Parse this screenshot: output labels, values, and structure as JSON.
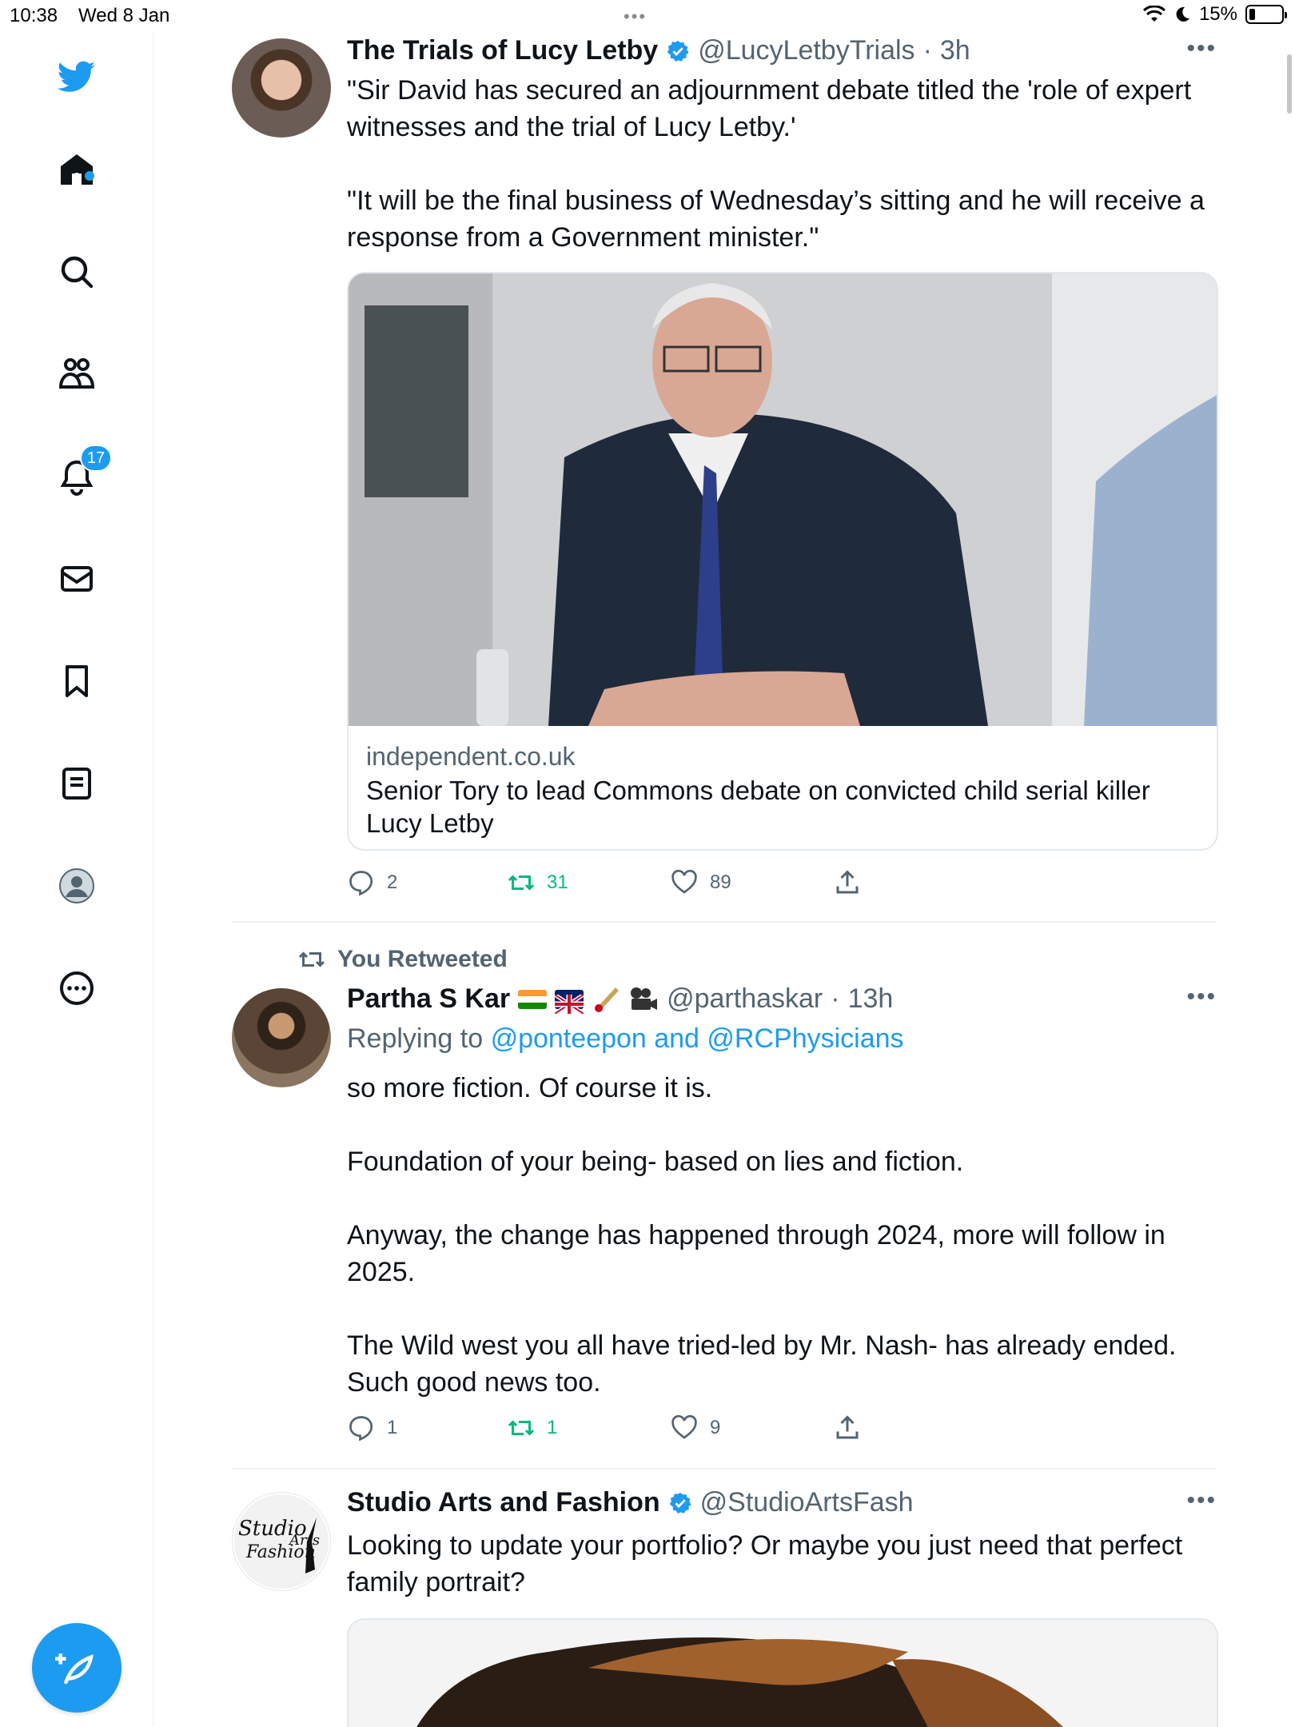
{
  "status_bar": {
    "time": "10:38",
    "date": "Wed 8 Jan",
    "battery": "15%",
    "battery_level": 0.15
  },
  "sidebar": {
    "items": [
      {
        "id": "twitter-logo",
        "label": "Twitter"
      },
      {
        "id": "home",
        "label": "Home"
      },
      {
        "id": "search",
        "label": "Search"
      },
      {
        "id": "communities",
        "label": "Communities"
      },
      {
        "id": "notifications",
        "label": "Notifications"
      },
      {
        "id": "messages",
        "label": "Messages"
      },
      {
        "id": "bookmarks",
        "label": "Bookmarks"
      },
      {
        "id": "lists",
        "label": "Lists"
      },
      {
        "id": "profile",
        "label": "Profile"
      },
      {
        "id": "more",
        "label": "More"
      }
    ],
    "notification_count": "17"
  },
  "tweets": [
    {
      "name": "The Trials of Lucy Letby",
      "handle": "@LucyLetbyTrials",
      "time": "3h",
      "verified": true,
      "text": [
        "\"Sir David has secured an adjournment debate titled the 'role of expert witnesses and the trial of Lucy Letby.'",
        "\"It will be the final business of Wednesday’s sitting and he will receive a response from a Government minister.\""
      ],
      "card": {
        "domain": "independent.co.uk",
        "title": "Senior Tory to lead Commons debate on convicted child serial killer Lucy Letby"
      },
      "replies": "2",
      "retweets": "31",
      "likes": "89"
    },
    {
      "retweet_label": "You Retweeted",
      "name": "Partha S Kar",
      "handle": "@parthaskar",
      "time": "13h",
      "reply_prefix": "Replying to",
      "reply_targets": "@ponteepon and @RCPhysicians",
      "text": [
        "so more fiction. Of course it is.",
        "Foundation of your being- based on lies and fiction.",
        "Anyway, the change has happened through 2024, more will follow in 2025.",
        "The Wild west you all have tried-led by Mr. Nash- has already ended. Such good news too."
      ],
      "replies": "1",
      "retweets": "1",
      "likes": "9"
    },
    {
      "name": "Studio Arts and Fashion",
      "handle": "@StudioArtsFash",
      "verified": true,
      "avatar_text": "Studio Arts and Fashion",
      "text": [
        "Looking to update your portfolio? Or maybe you just need that perfect family portrait?"
      ]
    }
  ],
  "colors": {
    "accent": "#1d9bf0",
    "retweet": "#00ba7c",
    "muted": "#536471"
  }
}
